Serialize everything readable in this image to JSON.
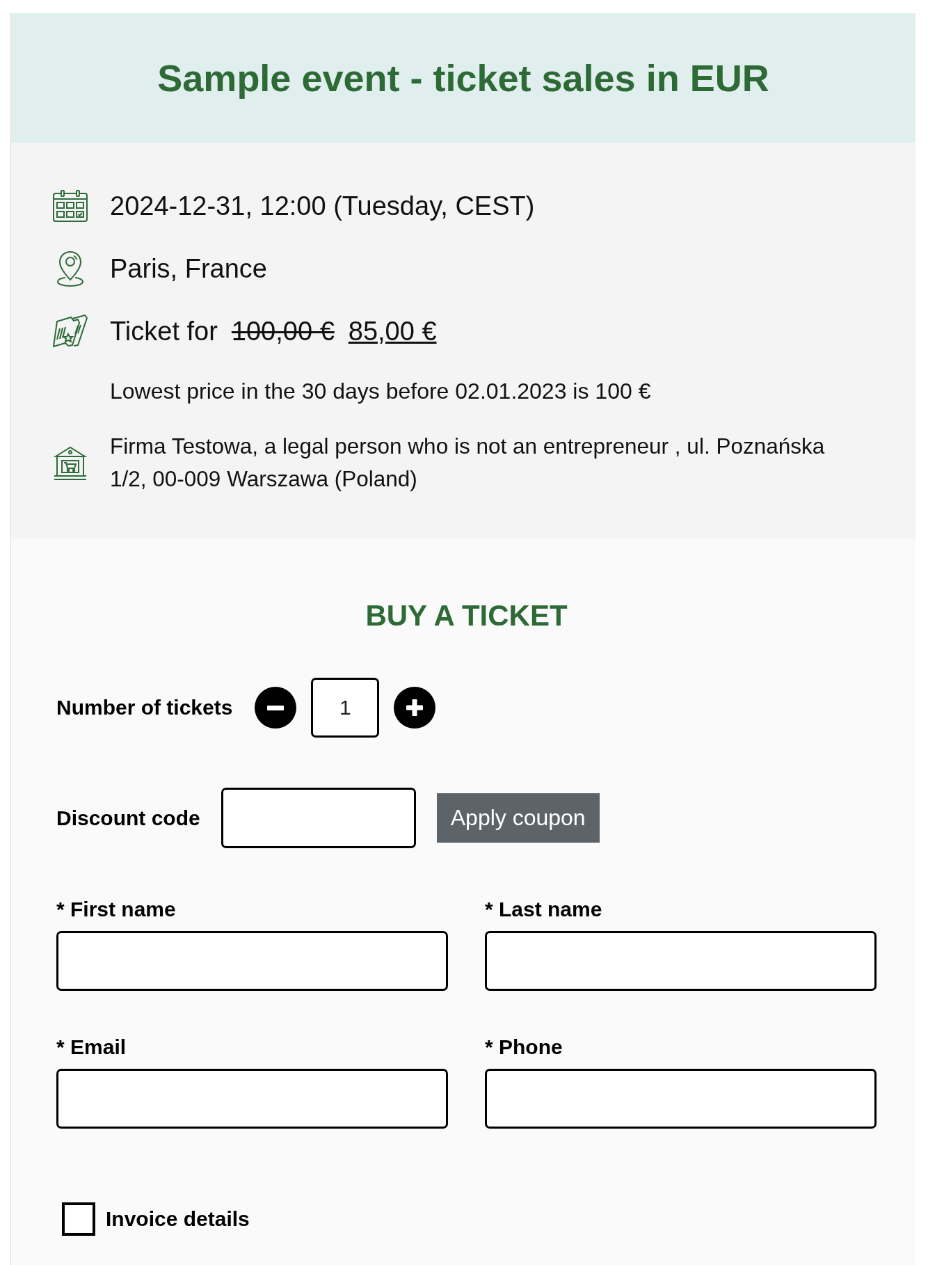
{
  "header": {
    "title": "Sample event - ticket sales in EUR"
  },
  "info": {
    "date": "2024-12-31, 12:00 (Tuesday, CEST)",
    "location": "Paris, France",
    "ticket": {
      "label": "Ticket for",
      "old_price": "100,00 €",
      "price": "85,00 €"
    },
    "lowest_price_note": "Lowest price in the 30 days before 02.01.2023 is 100 €",
    "organizer": "Firma Testowa, a legal person who is not an entrepreneur , ul. Poznańska 1/2, 00-009 Warszawa (Poland)"
  },
  "form": {
    "title": "BUY A TICKET",
    "quantity": {
      "label": "Number of tickets",
      "value": "1"
    },
    "discount": {
      "label": "Discount code",
      "button": "Apply coupon"
    },
    "fields": [
      {
        "label": "* First name"
      },
      {
        "label": "* Last name"
      },
      {
        "label": "* Email"
      },
      {
        "label": "* Phone"
      }
    ],
    "invoice": {
      "label": "Invoice details",
      "checked": false
    }
  }
}
